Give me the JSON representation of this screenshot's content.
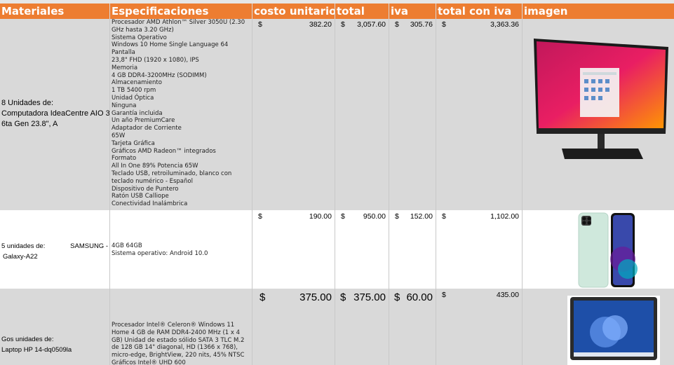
{
  "headers": {
    "materiales": "Materiales",
    "especificaciones": "Especificaciones",
    "costo_unitario": "costo unitario",
    "total": "total",
    "iva": "iva",
    "total_con_iva": "total con iva",
    "imagen": "imagen"
  },
  "rows": [
    {
      "material_line1": "8 Unidades de:",
      "material_line2": "Computadora IdeaCentre AIO 3",
      "material_line3": "6ta Gen 23.8\", A",
      "specs": [
        "Procesador AMD Athlon™ Silver 3050U (2.30",
        "GHz hasta 3.20 GHz)",
        "Sistema Operativo",
        "Windows 10 Home Single Language 64",
        "Pantalla",
        "23,8\" FHD (1920 x 1080), IPS",
        "Memoria",
        "4 GB DDR4-3200MHz (SODIMM)",
        "Almacenamiento",
        "1 TB 5400 rpm",
        "Unidad Óptica",
        "Ninguna",
        "Garantía incluida",
        "Un año PremiumCare",
        "Adaptador de Corriente",
        "65W",
        "Tarjeta Gráfica",
        "Gráficos AMD Radeon™ integrados",
        "Formato",
        "All In One 89% Potencia 65W",
        "Teclado USB, retroiluminado, blanco con",
        "teclado numérico - Español",
        "Dispositivo de Puntero",
        "Ratón USB Calliope",
        "Conectividad Inalámbrica"
      ],
      "currency": "$",
      "costo_unitario": "382.20",
      "total": "3,057.60",
      "iva": "305.76",
      "total_con_iva": "3,363.36",
      "image_icon": "all-in-one-computer-image"
    },
    {
      "material_line1": "5 unidades de:",
      "material_brand": "SAMSUNG -",
      "material_line2": "Galaxy-A22",
      "specs": [
        "4GB 64GB",
        "Sistema operativo: Android 10.0"
      ],
      "currency": "$",
      "costo_unitario": "190.00",
      "total": "950.00",
      "iva": "152.00",
      "total_con_iva": "1,102.00",
      "image_icon": "smartphone-image"
    },
    {
      "material_line1": "Gos unidades de:",
      "material_line2": "Laptop HP 14-dq0509la",
      "specs": [
        "Procesador Intel® Celeron® Windows 11",
        "Home 4 GB de RAM DDR4-2400 MHz (1 x 4",
        "GB) Unidad de estado sólido SATA 3 TLC M.2",
        "de 128 GB 14\" diagonal, HD (1366 x 768),",
        "micro-edge, BrightView, 220 nits, 45% NTSC",
        "Gráficos Intel® UHD 600"
      ],
      "currency": "$",
      "costo_unitario": "375.00",
      "total": "375.00",
      "iva": "60.00",
      "total_con_iva": "435.00",
      "image_icon": "laptop-image"
    }
  ],
  "colors": {
    "header_bg": "#ed7d31",
    "row_gray": "#d9d9d9",
    "header_text": "#ffffff"
  }
}
